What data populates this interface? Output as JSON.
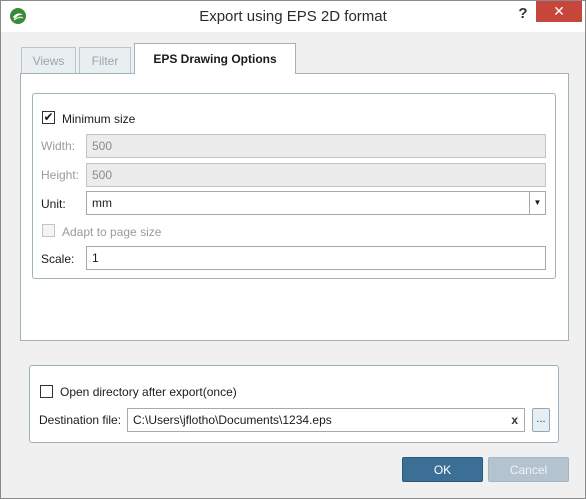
{
  "window": {
    "title": "Export using EPS 2D format",
    "help_label": "?",
    "close_label": "✕"
  },
  "tabs": [
    {
      "label": "Views",
      "active": false
    },
    {
      "label": "Filter",
      "active": false
    },
    {
      "label": "EPS Drawing Options",
      "active": true
    }
  ],
  "options": {
    "minimum_size": {
      "label": "Minimum size",
      "checked": true,
      "mark": "✔"
    },
    "width": {
      "label": "Width:",
      "value": "500"
    },
    "height": {
      "label": "Height:",
      "value": "500"
    },
    "unit": {
      "label": "Unit:",
      "value": "mm",
      "arrow": "▼"
    },
    "adapt": {
      "label": "Adapt to page size",
      "checked": false
    },
    "scale": {
      "label": "Scale:",
      "value": "1"
    }
  },
  "destination": {
    "open_dir": {
      "label": "Open directory after export(once)",
      "checked": false
    },
    "file_label": "Destination file:",
    "file_value": "C:\\Users\\jflotho\\Documents\\1234.eps",
    "clear_label": "x",
    "browse_label": "..."
  },
  "buttons": {
    "ok": "OK",
    "cancel": "Cancel"
  },
  "colors": {
    "close_button": "#c7463b",
    "primary_button": "#3c6f95",
    "disabled_button": "#b3c4d0",
    "group_border": "#9fb3be"
  }
}
